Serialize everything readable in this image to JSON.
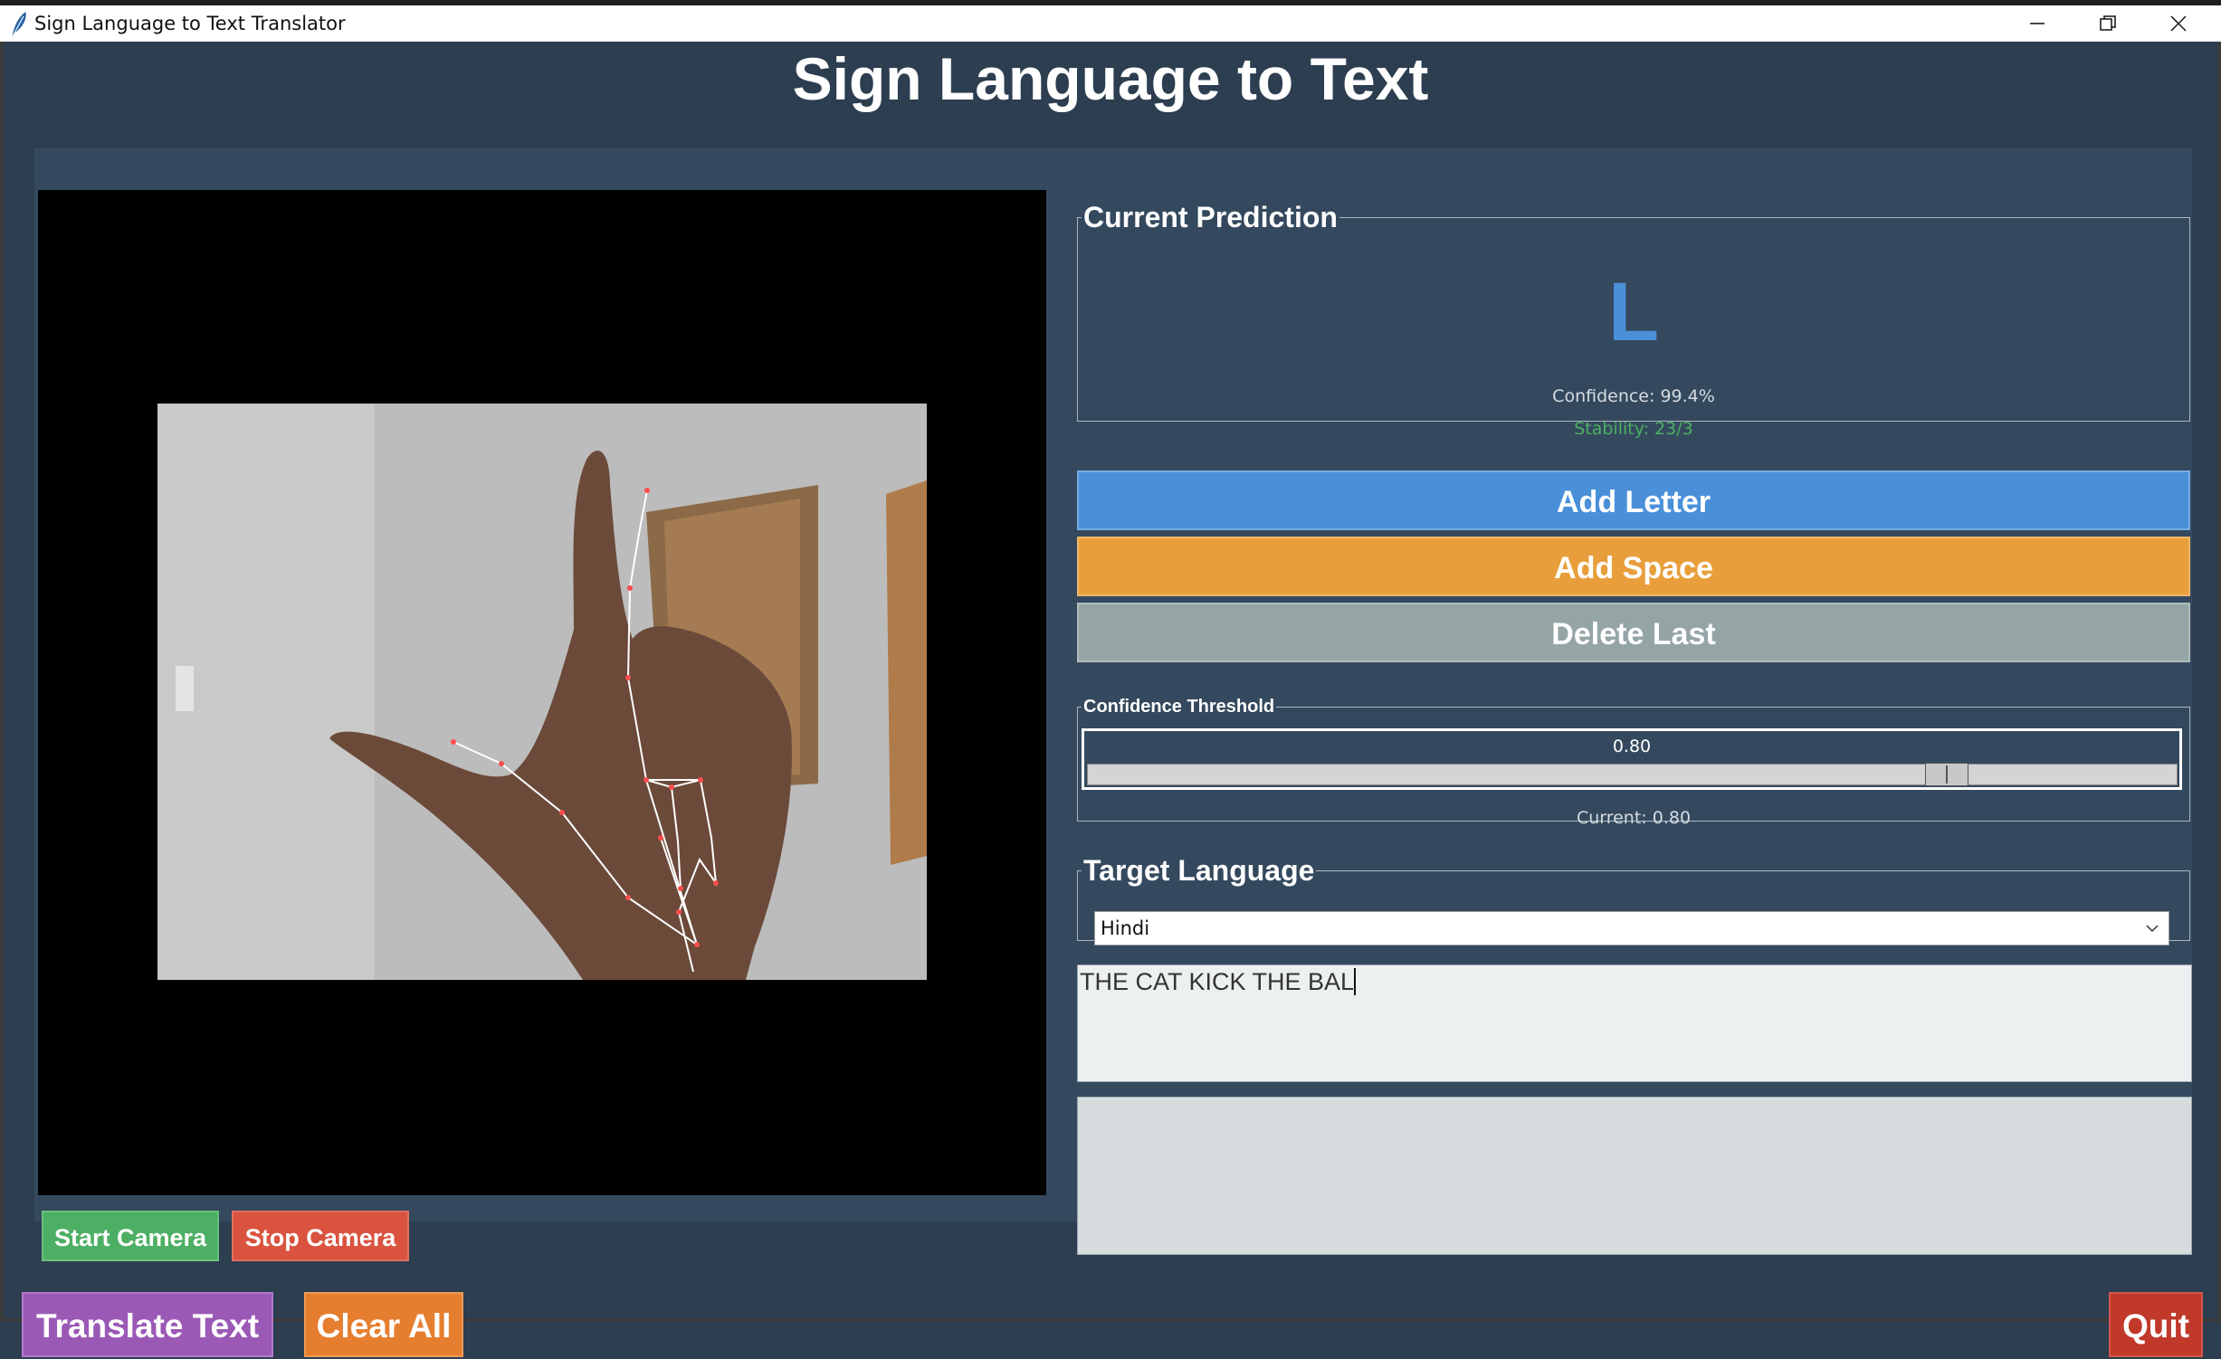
{
  "window": {
    "title": "Sign Language to Text Translator"
  },
  "app": {
    "heading": "Sign Language to Text"
  },
  "camera": {
    "start_label": "Start Camera",
    "stop_label": "Stop Camera"
  },
  "prediction": {
    "group_label": "Current Prediction",
    "letter": "L",
    "confidence_text": "Confidence: 99.4%",
    "stability_text": "Stability: 23/3"
  },
  "actions": {
    "add_letter": "Add Letter",
    "add_space": "Add Space",
    "delete_last": "Delete Last"
  },
  "threshold": {
    "group_label": "Confidence Threshold",
    "value_label": "0.80",
    "value": 0.8,
    "current_text": "Current: 0.80"
  },
  "language": {
    "group_label": "Target Language",
    "selected": "Hindi"
  },
  "text": {
    "composed": "THE CAT KICK THE BAL",
    "translated": ""
  },
  "footer": {
    "translate": "Translate Text",
    "clear": "Clear All",
    "quit": "Quit"
  },
  "colors": {
    "background": "#2c3e50",
    "panel": "#34495e",
    "accent_blue": "#4a90d9",
    "accent_orange": "#e89f3b",
    "accent_gray": "#95a5a6",
    "start_green": "#4caf63",
    "stop_red": "#d9533f",
    "translate_purple": "#9b59b6",
    "clear_orange": "#e67e2f",
    "quit_red": "#c0392b"
  },
  "icons": {
    "app": "feather-icon",
    "minimize": "minimize-icon",
    "maximize": "restore-icon",
    "close": "close-icon",
    "dropdown": "chevron-down-icon"
  }
}
